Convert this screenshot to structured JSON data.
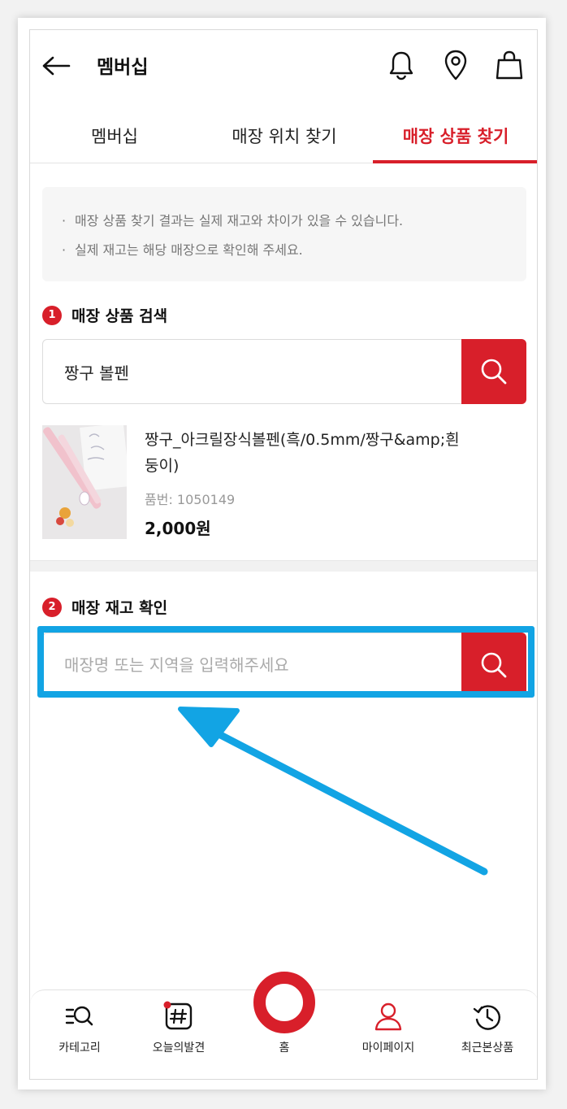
{
  "header": {
    "title": "멤버십"
  },
  "tabs": [
    {
      "label": "멤버십",
      "active": false
    },
    {
      "label": "매장 위치 찾기",
      "active": false
    },
    {
      "label": "매장 상품 찾기",
      "active": true
    }
  ],
  "notice": {
    "lines": [
      "매장 상품 찾기 결과는 실제 재고와 차이가 있을 수 있습니다.",
      "실제 재고는 해당 매장으로 확인해 주세요."
    ]
  },
  "product_search": {
    "step": "1",
    "title": "매장 상품 검색",
    "value": "짱구 볼펜"
  },
  "product": {
    "name": "짱구_아크릴장식볼펜(흑/0.5mm/짱구&amp;흰둥이)",
    "code": "품번: 1050149",
    "price": "2,000원"
  },
  "stock_check": {
    "step": "2",
    "title": "매장 재고 확인",
    "placeholder": "매장명 또는 지역을 입력해주세요",
    "value": ""
  },
  "bottom_nav": {
    "items": [
      {
        "label": "카테고리",
        "icon": "category-search-icon"
      },
      {
        "label": "오늘의발견",
        "icon": "hashtag-icon"
      },
      {
        "label": "홈",
        "icon": "home-ring-icon"
      },
      {
        "label": "마이페이지",
        "icon": "user-icon"
      },
      {
        "label": "최근본상품",
        "icon": "history-icon"
      }
    ]
  },
  "colors": {
    "accent": "#d81f2a",
    "highlight": "#12a4e4"
  }
}
